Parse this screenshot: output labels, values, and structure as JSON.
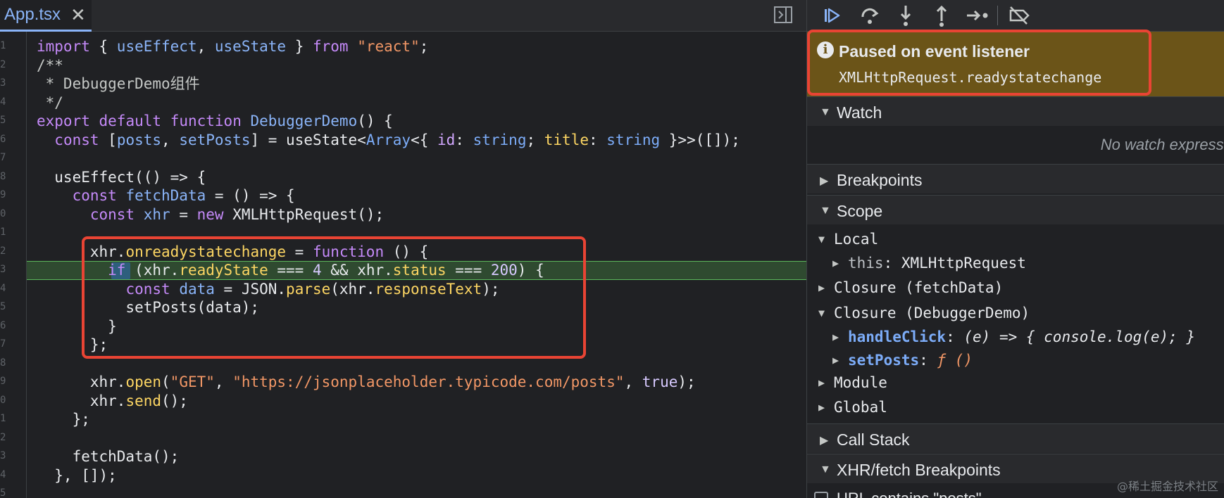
{
  "editor": {
    "tab_label": "App.tsx",
    "close_glyph": "✕",
    "gutter_marks": [
      "1",
      "2",
      "3",
      "4",
      "5",
      "6",
      "7",
      "8",
      "9",
      "0",
      "1",
      "2",
      "3",
      "4",
      "5",
      "6",
      "7",
      "8",
      "9",
      "0",
      "1",
      "2",
      "3",
      "4",
      "5"
    ]
  },
  "debugger": {
    "paused": {
      "icon": "i",
      "title": "Paused on event listener",
      "detail": "XMLHttpRequest.readystatechange"
    },
    "sections": {
      "watch": "Watch",
      "no_watch": "No watch expressions",
      "breakpoints": "Breakpoints",
      "scope": "Scope",
      "call_stack": "Call Stack",
      "xhr": "XHR/fetch Breakpoints"
    },
    "scope": {
      "local": "Local",
      "this_key": "this",
      "this_val": "XMLHttpRequest",
      "closure_fetch": "Closure (fetchData)",
      "closure_demo": "Closure (DebuggerDemo)",
      "handle_key": "handleClick",
      "handle_val": "(e) => { console.log(e); }",
      "setposts_key": "setPosts",
      "setposts_val": "ƒ ()",
      "module": "Module",
      "global": "Global"
    },
    "xhr_item": "URL contains \"posts\""
  },
  "watermark": "@稀土掘金技术社区"
}
